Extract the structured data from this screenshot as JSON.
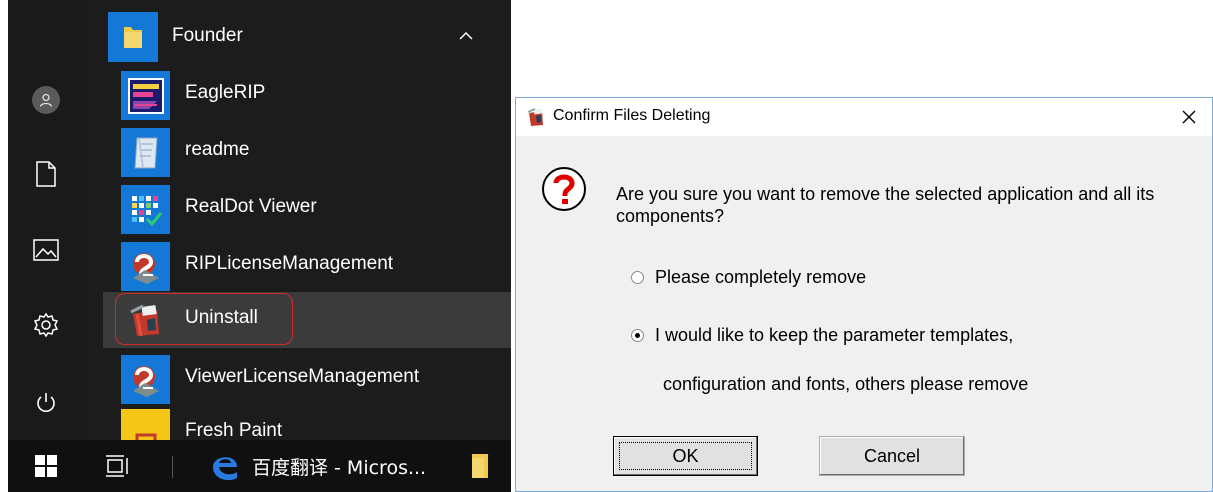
{
  "start_menu": {
    "group": {
      "label": "Founder"
    },
    "apps": [
      {
        "label": "EagleRIP",
        "icon": "eaglerip-icon"
      },
      {
        "label": "readme",
        "icon": "readme-icon"
      },
      {
        "label": "RealDot Viewer",
        "icon": "realdot-viewer-icon"
      },
      {
        "label": "RIPLicenseManagement",
        "icon": "license-icon"
      },
      {
        "label": "Uninstall",
        "icon": "uninstall-icon",
        "selected": true
      },
      {
        "label": "ViewerLicenseManagement",
        "icon": "license-icon"
      },
      {
        "label": "Fresh Paint",
        "icon": "fresh-paint-icon"
      }
    ],
    "rail": [
      "user-avatar",
      "document-icon",
      "pictures-icon",
      "settings-icon",
      "power-icon"
    ]
  },
  "taskbar": {
    "edge_label": "百度翻译 - Micros..."
  },
  "dialog": {
    "title": "Confirm Files Deleting",
    "message": "Are you sure you want to remove the selected application and all its components?",
    "option1": "Please completely remove",
    "option2_line1": "I would like to keep the parameter templates,",
    "option2_line2": "configuration and fonts, others please remove",
    "selected_option": 2,
    "ok_label": "OK",
    "cancel_label": "Cancel"
  },
  "colors": {
    "tile_blue": "#1479d6",
    "start_bg": "#1c1c1c",
    "highlight_red": "#d42a2a",
    "dialog_border": "#7aaadf"
  }
}
